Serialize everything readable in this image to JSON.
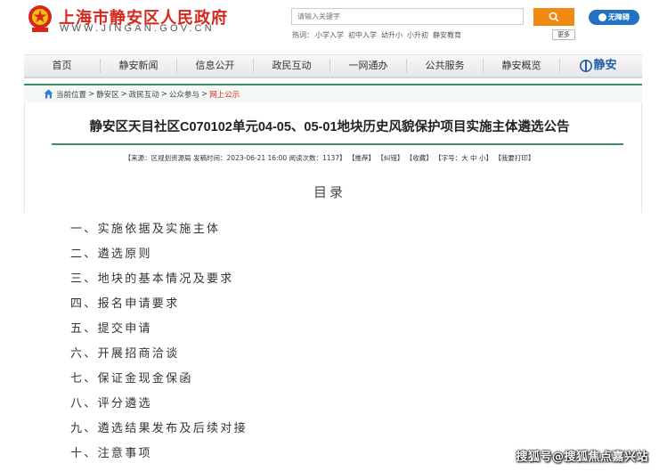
{
  "header": {
    "site_name": "上海市静安区人民政府",
    "site_url": "WWW.JINGAN.GOV.CN",
    "emblem_colors": {
      "primary": "#d7261b",
      "secondary": "#f4c20d"
    }
  },
  "search": {
    "placeholder": "请输入关键字",
    "button_icon": "search-icon",
    "accent": "#f18a12"
  },
  "accessibility": {
    "label": "无障碍",
    "icon": "accessibility-icon"
  },
  "hotwords": {
    "label": "热词：",
    "items": [
      "小学入学",
      "初中入学",
      "幼升小",
      "小升初",
      "静安教育"
    ],
    "more_label": "更多"
  },
  "nav": {
    "items": [
      "首页",
      "静安新闻",
      "信息公开",
      "政民互动",
      "一网通办",
      "公共服务",
      "静安概览"
    ],
    "logo_text": "静安"
  },
  "breadcrumb": {
    "lead": "当前位置",
    "items": [
      "静安区",
      "政民互动",
      "公众参与"
    ],
    "current": "网上公示"
  },
  "article": {
    "title": "静安区天目社区C070102单元04-05、05-01地块历史风貌保护项目实施主体遴选公告",
    "meta": {
      "source": "【来源：区规划资源局",
      "publish_time": "发稿时间：2023-06-21 16:00",
      "views": "阅读次数：1137】",
      "recommend": "【推荐】",
      "correct": "【纠错】",
      "favorite": "【收藏】",
      "font_size": "【字号：大 中 小】",
      "print": "【我要打印】"
    },
    "toc_heading": "目录",
    "toc": [
      "一、实施依据及实施主体",
      "二、遴选原则",
      "三、地块的基本情况及要求",
      "四、报名申请要求",
      "五、提交申请",
      "六、开展招商洽谈",
      "七、保证金现金保函",
      "八、评分遴选",
      "九、遴选结果发布及后续对接",
      "十、注意事项"
    ]
  },
  "watermark": "搜狐号@搜狐焦点嘉兴站",
  "colors": {
    "brand_red": "#d7261b",
    "theme_green": "#3d8f62",
    "link_blue": "#2272c3"
  }
}
